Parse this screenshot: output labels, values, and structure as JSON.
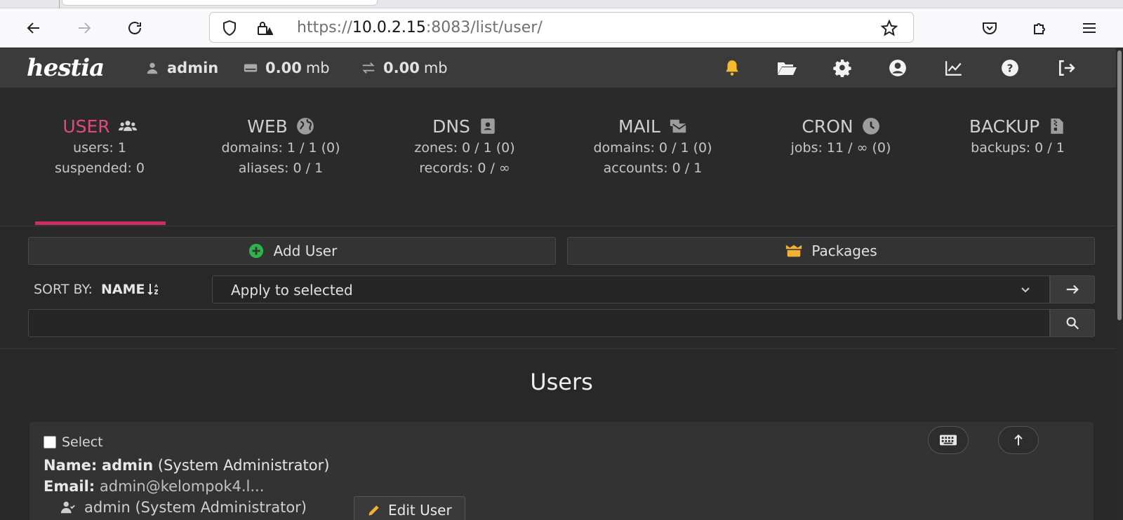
{
  "browser": {
    "url_prefix": "https://",
    "url_host": "10.0.2.15",
    "url_rest": ":8083/list/user/"
  },
  "topbar": {
    "logo": "hestia",
    "user": "admin",
    "disk_value": "0.00",
    "disk_unit": "mb",
    "bandwidth_value": "0.00",
    "bandwidth_unit": "mb",
    "icons": [
      "bell-icon",
      "folder-open-icon",
      "gear-icon",
      "user-circle-icon",
      "chart-line-icon",
      "help-icon",
      "logout-icon"
    ]
  },
  "stats": [
    {
      "title": "USER",
      "icon": "users-icon",
      "lines": [
        "users: 1",
        "suspended: 0"
      ]
    },
    {
      "title": "WEB",
      "icon": "globe-icon",
      "lines": [
        "domains: 1 / 1 (0)",
        "aliases: 0 / 1"
      ]
    },
    {
      "title": "DNS",
      "icon": "address-book-icon",
      "lines": [
        "zones: 0 / 1 (0)",
        "records: 0 / ∞"
      ]
    },
    {
      "title": "MAIL",
      "icon": "mail-bulk-icon",
      "lines": [
        "domains: 0 / 1 (0)",
        "accounts: 0 / 1"
      ]
    },
    {
      "title": "CRON",
      "icon": "clock-icon",
      "lines": [
        "jobs: 11 / ∞ (0)"
      ]
    },
    {
      "title": "BACKUP",
      "icon": "file-archive-icon",
      "lines": [
        "backups: 0 / 1"
      ]
    }
  ],
  "toolbar": {
    "add_user": "Add User",
    "packages": "Packages",
    "sort_by_label": "SORT BY:",
    "sort_by_value": "NAME",
    "bulk_action": "Apply to selected",
    "search_placeholder": ""
  },
  "page_title": "Users",
  "user_card": {
    "select_label": "Select",
    "name_label": "Name:",
    "name_value": "admin",
    "name_role": "(System Administrator)",
    "email_label": "Email:",
    "email_value": "admin@kelompok4.l...",
    "footer_user": "admin (System Administrator)",
    "edit_label": "Edit User"
  },
  "colors": {
    "accent": "#cc2f63",
    "background": "#282828",
    "topbar": "#3b3b3b"
  }
}
